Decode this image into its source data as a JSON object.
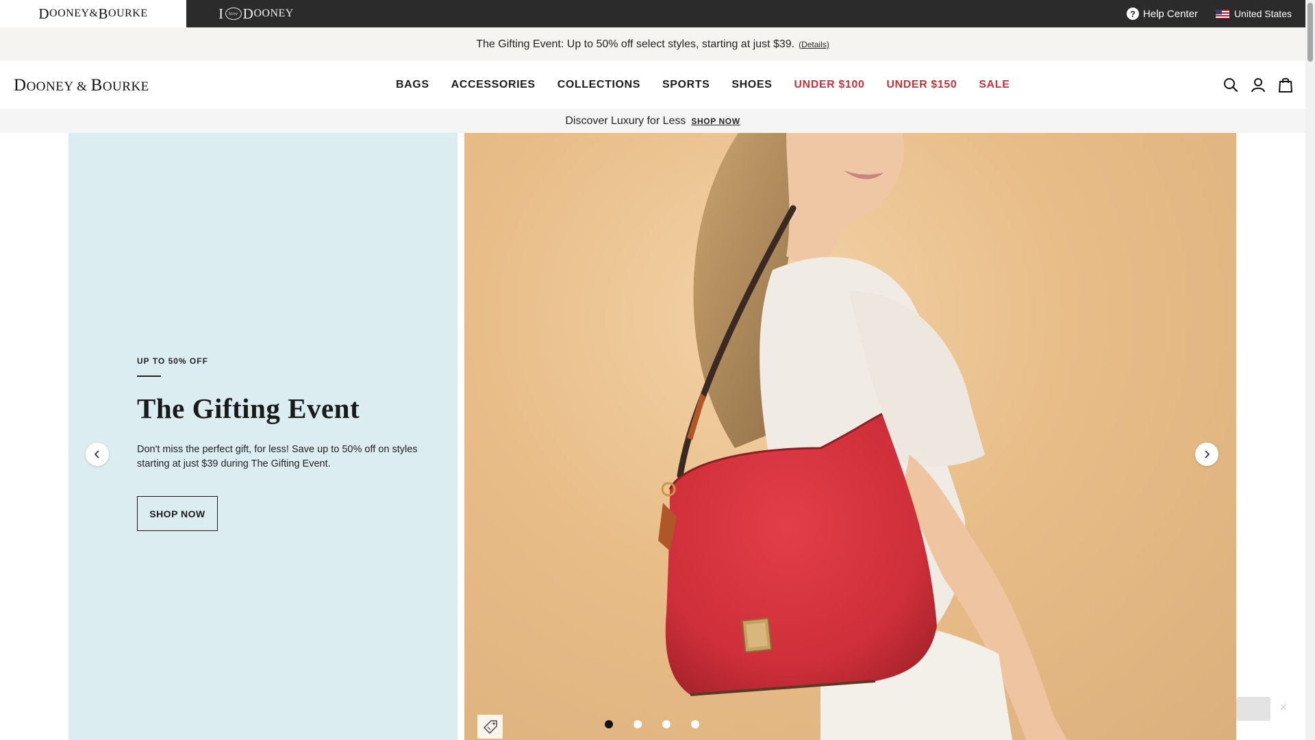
{
  "utility_bar": {
    "brand_tabs": [
      {
        "label_part1": "D",
        "label_part1_small": "OONEY",
        "label_amp": " & ",
        "label_part2": "B",
        "label_part2_small": "OURKE"
      },
      {
        "label_prefix": "I",
        "heart_text": "love",
        "label_part1": "D",
        "label_part1_small": "OONEY"
      }
    ],
    "help_label": "Help Center",
    "help_icon": "question-circle-icon",
    "region_label": "United States",
    "region_icon": "us-flag-icon"
  },
  "promo": {
    "text": "The Gifting Event: Up to 50% off select styles, starting at just $39.",
    "details_label": "(Details)"
  },
  "header": {
    "logo": {
      "part1": "D",
      "part1_small": "OONEY",
      "amp": " & ",
      "part2": "B",
      "part2_small": "OURKE"
    },
    "nav": [
      {
        "label": "BAGS",
        "accent": false
      },
      {
        "label": "ACCESSORIES",
        "accent": false
      },
      {
        "label": "COLLECTIONS",
        "accent": false
      },
      {
        "label": "SPORTS",
        "accent": false
      },
      {
        "label": "SHOES",
        "accent": false
      },
      {
        "label": "UNDER $100",
        "accent": true
      },
      {
        "label": "UNDER $150",
        "accent": true
      },
      {
        "label": "SALE",
        "accent": true
      }
    ],
    "icons": [
      "search-icon",
      "account-icon",
      "shopping-bag-icon"
    ],
    "accent_color": "#c8323c"
  },
  "discover": {
    "text": "Discover Luxury for Less",
    "link_label": "SHOP NOW"
  },
  "hero": {
    "eyebrow": "UP TO 50% OFF",
    "title": "The Gifting Event",
    "body": "Don't miss the perfect gift, for less! Save up to 50% off on styles starting at just $39 during The Gifting Event.",
    "cta_label": "SHOP NOW",
    "panel_color": "#dcedf1",
    "image_subject": "Woman wearing a red pebbled-leather Dooney & Bourke shoulder bag",
    "bag_color": "#d9353e",
    "prev_icon": "chevron-left-icon",
    "next_icon": "chevron-right-icon",
    "tag_icon": "price-tag-icon",
    "slides_count": 4,
    "active_slide": 1
  }
}
